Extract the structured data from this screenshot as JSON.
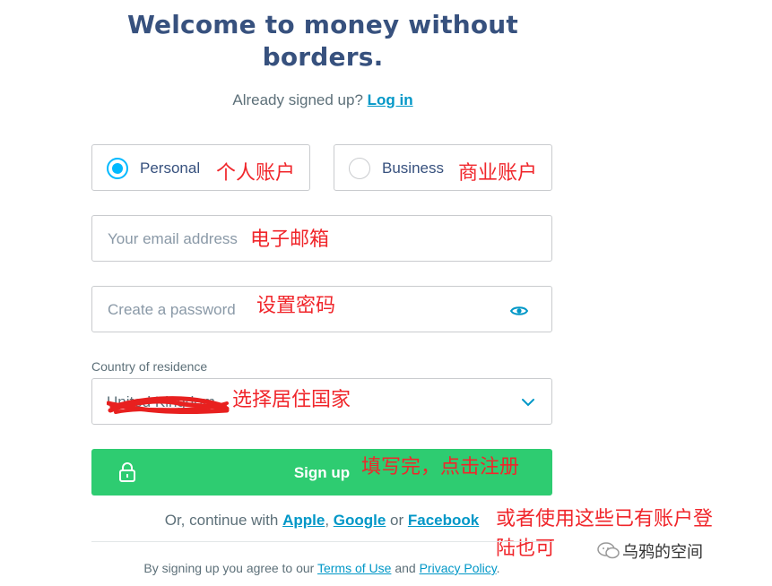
{
  "heading": {
    "line1": "Welcome to money without",
    "line2": "borders."
  },
  "already": {
    "text": "Already signed up? ",
    "login": "Log in"
  },
  "account_type": {
    "personal": "Personal",
    "business": "Business",
    "selected": "personal"
  },
  "email": {
    "placeholder": "Your email address"
  },
  "password": {
    "placeholder": "Create a password"
  },
  "country": {
    "label": "Country of residence",
    "value": "United Kingdom"
  },
  "signup": {
    "label": "Sign up"
  },
  "continue": {
    "prefix": "Or, continue with ",
    "apple": "Apple",
    "sep1": ", ",
    "google": "Google",
    "sep2": " or ",
    "facebook": "Facebook"
  },
  "terms": {
    "prefix": "By signing up you agree to our ",
    "terms_link": "Terms of Use",
    "and": " and ",
    "privacy_link": "Privacy Policy",
    "suffix": "."
  },
  "annotations": {
    "personal": "个人账户",
    "business": "商业账户",
    "email": "电子邮箱",
    "password": "设置密码",
    "country": "选择居住国家",
    "signup": "填写完，点击注册",
    "social_line1": "或者使用这些已有账户登",
    "social_line2": "陆也可"
  },
  "watermark": "乌鸦的空间",
  "colors": {
    "title": "#37517e",
    "accent": "#00b9ff",
    "link": "#0097c7",
    "button": "#2ecc71",
    "annotation": "#f0262b"
  }
}
